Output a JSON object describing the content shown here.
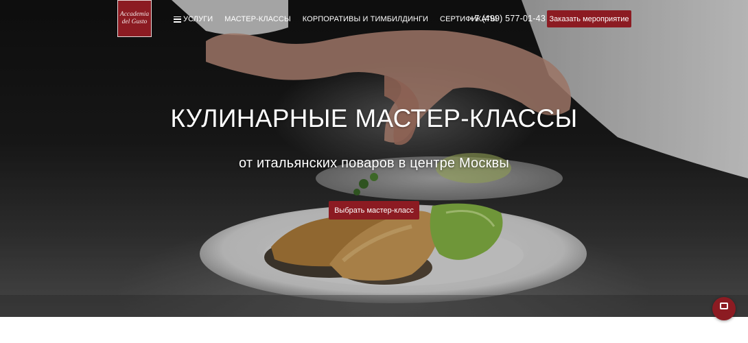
{
  "header": {
    "logo": {
      "line1": "Accademia",
      "line2": "del Gusto"
    },
    "nav": [
      {
        "label": "УСЛУГИ",
        "icon": "menu-icon"
      },
      {
        "label": "МАСТЕР-КЛАССЫ"
      },
      {
        "label": "КОРПОРАТИВЫ И ТИМБИЛДИНГИ"
      },
      {
        "label": "СЕРТИФИКАТЫ"
      }
    ],
    "phone": "+7 (499) 577-01-43",
    "order_button": "Заказать мероприятие"
  },
  "hero": {
    "title": "КУЛИНАРНЫЕ МАСТЕР-КЛАССЫ",
    "subtitle": "от итальянских поваров в центре Москвы",
    "cta_button": "Выбрать мастер-класс"
  },
  "chat_widget": {
    "icon": "chat-icon"
  },
  "colors": {
    "accent": "#8c1b22",
    "text": "#ffffff"
  }
}
